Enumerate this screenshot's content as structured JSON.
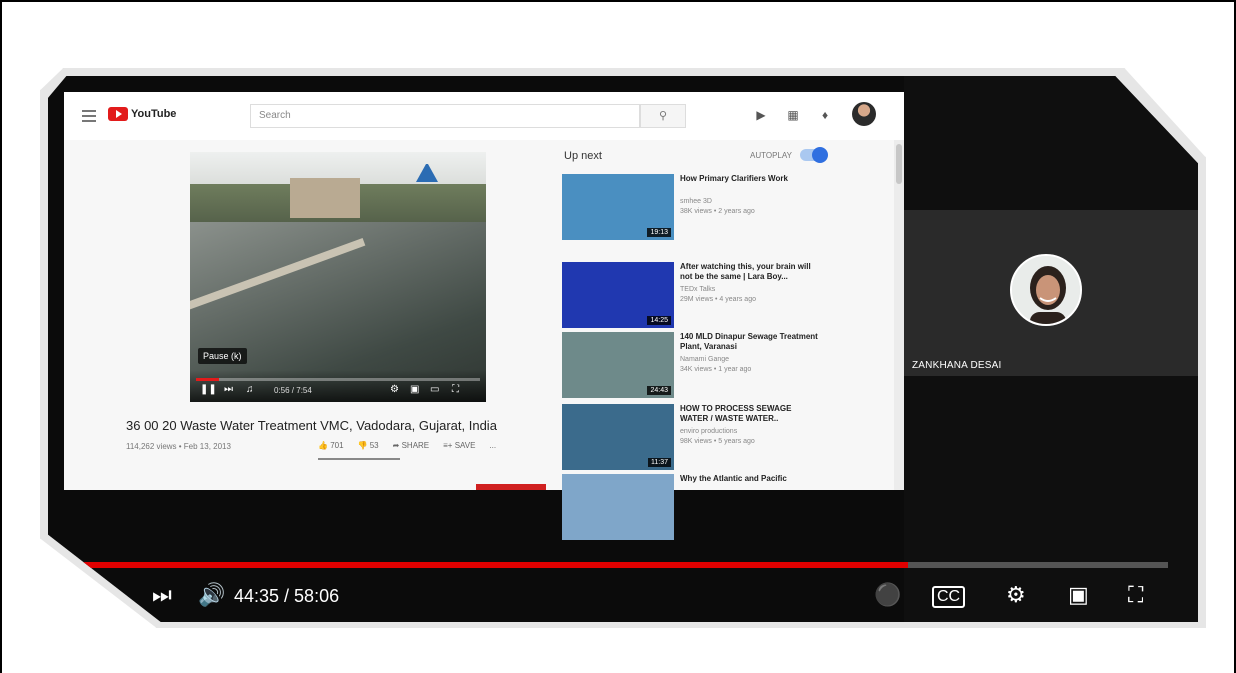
{
  "youtube": {
    "logo_text": "YouTube",
    "search_placeholder": "Search",
    "video_title": "36 00 20 Waste Water Treatment VMC, Vadodara, Gujarat, India",
    "video_meta": "114,262 views • Feb 13, 2013",
    "likes": "701",
    "dislikes": "53",
    "share_label": "SHARE",
    "save_label": "SAVE",
    "more_label": "...",
    "pause_tooltip": "Pause (k)",
    "player_time": "0:56 / 7:54",
    "up_next_label": "Up next",
    "autoplay_label": "AUTOPLAY",
    "autoplay_on": true,
    "recommendations": [
      {
        "title": "How Primary Clarifiers Work",
        "channel": "smhee 3D",
        "views": "38K views • 2 years ago",
        "duration": "19:13",
        "thumb_color": "#4a8fc1"
      },
      {
        "title": "After watching this, your brain will not be the same | Lara Boy...",
        "channel": "TEDx Talks",
        "views": "29M views • 4 years ago",
        "duration": "14:25",
        "thumb_color": "#2038b0"
      },
      {
        "title": "140 MLD Dinapur Sewage Treatment Plant, Varanasi",
        "channel": "Namami Gange",
        "views": "34K views • 1 year ago",
        "duration": "24:43",
        "thumb_color": "#6e8a8a"
      },
      {
        "title": "HOW TO PROCESS SEWAGE WATER / WASTE WATER..",
        "channel": "enviro productions",
        "views": "98K views • 5 years ago",
        "duration": "11:37",
        "thumb_color": "#3b6b8c"
      },
      {
        "title": "Why the Atlantic and Pacific",
        "channel": "",
        "views": "",
        "duration": "",
        "thumb_color": "#7fa6c9"
      }
    ]
  },
  "participant": {
    "name": "ZANKHANA DESAI"
  },
  "player": {
    "time": "44:35 / 58:06",
    "progress": 0.768,
    "progress_color": "#e00000"
  }
}
